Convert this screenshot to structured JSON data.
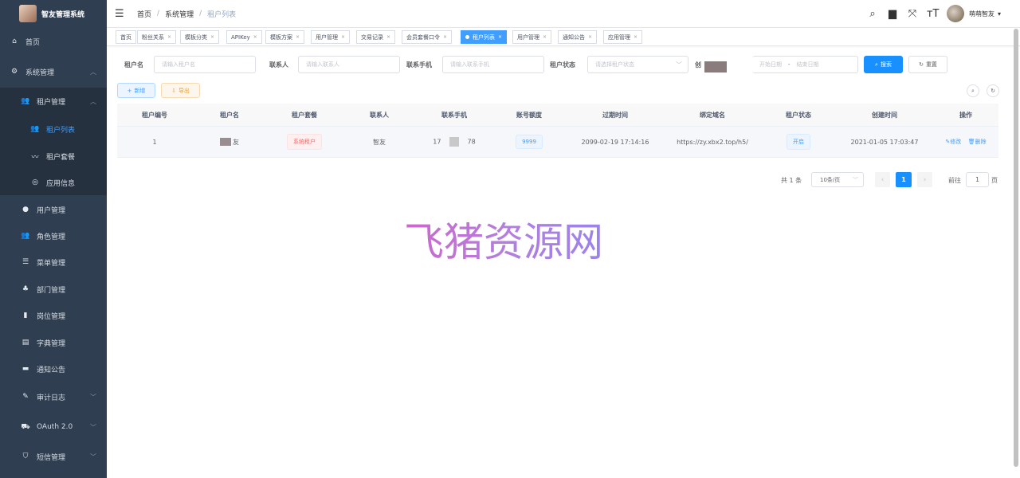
{
  "app": {
    "title": "智友管理系统"
  },
  "sidebar": {
    "items": [
      {
        "label": "首页",
        "icon": "dashboard-icon"
      },
      {
        "label": "系统管理",
        "icon": "gear-icon"
      },
      {
        "label": "租户管理",
        "icon": "users-icon"
      },
      {
        "label": "租户列表",
        "icon": "user-list-icon"
      },
      {
        "label": "租户套餐",
        "icon": "package-icon"
      },
      {
        "label": "应用信息",
        "icon": "info-icon"
      },
      {
        "label": "用户管理",
        "icon": "user-icon"
      },
      {
        "label": "角色管理",
        "icon": "role-icon"
      },
      {
        "label": "菜单管理",
        "icon": "menu-tree-icon"
      },
      {
        "label": "部门管理",
        "icon": "org-icon"
      },
      {
        "label": "岗位管理",
        "icon": "post-icon"
      },
      {
        "label": "字典管理",
        "icon": "dictionary-icon"
      },
      {
        "label": "通知公告",
        "icon": "message-icon"
      },
      {
        "label": "审计日志",
        "icon": "log-icon"
      },
      {
        "label": "OAuth 2.0",
        "icon": "oauth-icon"
      },
      {
        "label": "短信管理",
        "icon": "shield-icon"
      }
    ]
  },
  "breadcrumb": [
    "首页",
    "系统管理",
    "租户列表"
  ],
  "user": {
    "name": "萌萌智友"
  },
  "tags": [
    {
      "label": "首页"
    },
    {
      "label": "粉丝关系"
    },
    {
      "label": "模板分类"
    },
    {
      "label": "APIKey"
    },
    {
      "label": "模板方案"
    },
    {
      "label": "用户管理"
    },
    {
      "label": "交易记录"
    },
    {
      "label": "会员套餐口令"
    },
    {
      "label": "租户列表"
    },
    {
      "label": "用户管理"
    },
    {
      "label": "通知公告"
    },
    {
      "label": "应用管理"
    }
  ],
  "search": {
    "tenant_name_label": "租户名",
    "tenant_name_placeholder": "请输入租户名",
    "contact_label": "联系人",
    "contact_placeholder": "请输入联系人",
    "phone_label": "联系手机",
    "phone_placeholder": "请输入联系手机",
    "status_label": "租户状态",
    "status_placeholder": "请选择租户状态",
    "created_label": "创",
    "start_date": "开始日期",
    "date_sep": "-",
    "end_date": "结束日期",
    "search_button": "搜索",
    "reset_button": "重置"
  },
  "actions": {
    "add": "新增",
    "export": "导出"
  },
  "table": {
    "headers": [
      "租户编号",
      "租户名",
      "租户套餐",
      "联系人",
      "联系手机",
      "账号额度",
      "过期时间",
      "绑定域名",
      "租户状态",
      "创建时间",
      "操作"
    ],
    "rows": [
      {
        "id": "1",
        "name": "友",
        "package": "系统租户",
        "contact": "智友",
        "phone_start": "17",
        "phone_end": "78",
        "quota": "9999",
        "expire": "2099-02-19 17:14:16",
        "domain": "https://zy.xbx2.top/h5/",
        "status": "开启",
        "created": "2021-01-05 17:03:47",
        "edit": "修改",
        "delete": "删除"
      }
    ]
  },
  "pagination": {
    "total": "共 1 条",
    "page_size": "10条/页",
    "current": "1",
    "goto_label": "前往",
    "goto_value": "1",
    "page_suffix": "页"
  },
  "watermark": "飞猪资源网",
  "colors": {
    "sidebar_bg": "#2f3e50",
    "primary": "#1890ff",
    "danger": "#f56c6c",
    "warning": "#e6a23c"
  }
}
